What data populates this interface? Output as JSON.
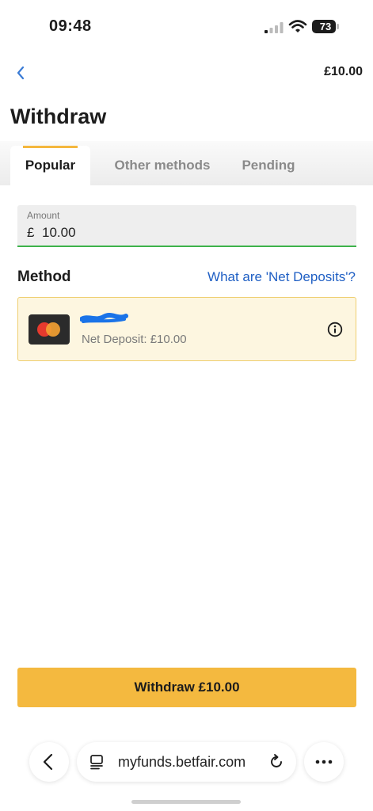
{
  "status_bar": {
    "time": "09:48",
    "battery": "73",
    "icons": [
      "signal-icon",
      "wifi-icon",
      "battery-icon"
    ]
  },
  "header": {
    "back_icon": "chevron-left-icon",
    "balance": "£10.00"
  },
  "page": {
    "title": "Withdraw"
  },
  "tabs": [
    {
      "label": "Popular",
      "active": true
    },
    {
      "label": "Other methods",
      "active": false
    },
    {
      "label": "Pending",
      "active": false
    }
  ],
  "amount": {
    "label": "Amount",
    "currency": "£",
    "value": "10.00"
  },
  "method": {
    "label": "Method",
    "help_link": "What are 'Net Deposits'?",
    "card": {
      "icon": "mastercard-icon",
      "net_deposit": "Net Deposit: £10.00",
      "info_icon": "info-icon"
    }
  },
  "withdraw_button": "Withdraw £10.00",
  "browser": {
    "url": "myfunds.betfair.com",
    "icons": [
      "back-icon",
      "tabs-icon",
      "reload-icon",
      "more-icon"
    ]
  },
  "colors": {
    "accent": "#f4b93f",
    "link": "#1f5fc4",
    "input_underline": "#3db24a",
    "card_bg": "#fdf6e0",
    "card_border": "#efcf71"
  }
}
